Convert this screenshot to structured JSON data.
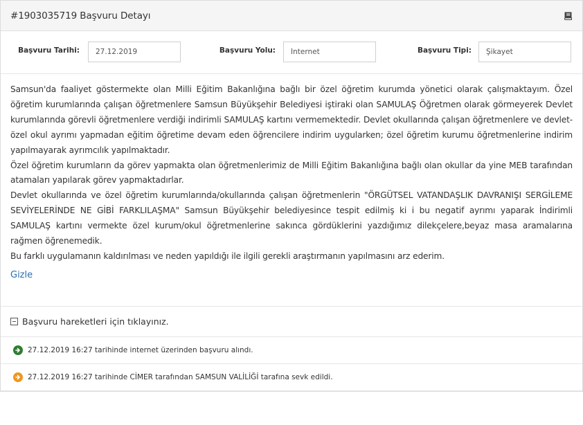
{
  "header": {
    "title": "#1903035719 Başvuru Detayı",
    "icon": "book-icon"
  },
  "fields": {
    "date_label": "Başvuru Tarihi:",
    "date_value": "27.12.2019",
    "channel_label": "Başvuru Yolu:",
    "channel_value": "İnternet",
    "type_label": "Başvuru Tipi:",
    "type_value": "Şikayet"
  },
  "description": {
    "paragraphs": [
      "Samsun'da faaliyet göstermekte olan Milli Eğitim Bakanlığına bağlı bir özel öğretim kurumda yönetici olarak çalışmaktayım. Özel öğretim kurumlarında çalışan öğretmenlere Samsun Büyükşehir Belediyesi iştiraki olan SAMULAŞ Öğretmen olarak görmeyerek Devlet kurumlarında görevli öğretmenlere verdiği indirimli SAMULAŞ kartını vermemektedir. Devlet okullarında çalışan öğretmenlere ve devlet-özel okul ayrımı yapmadan eğitim öğretime devam eden öğrencilere indirim uygularken; özel öğretim kurumu öğretmenlerine indirim yapılmayarak ayrımcılık yapılmaktadır.",
      "Özel öğretim kurumların da görev yapmakta olan öğretmenlerimiz de Milli Eğitim Bakanlığına bağlı olan okullar da yine MEB tarafından atamaları yapılarak görev yapmaktadırlar.",
      "Devlet okullarında ve özel öğretim kurumlarında/okullarında çalışan öğretmenlerin \"ÖRGÜTSEL VATANDAŞLIK DAVRANIŞI SERGİLEME SEVİYELERİNDE NE GİBİ FARKLILAŞMA\" Samsun Büyükşehir belediyesince tespit edilmiş ki i bu negatif ayrımı yaparak İndirimli SAMULAŞ kartını vermekte özel kurum/okul öğretmenlerine sakınca gördüklerini yazdığımız dilekçelere,beyaz masa aramalarına rağmen öğrenemedik.",
      "Bu farklı uygulamanın kaldırılması ve neden yapıldığı ile ilgili gerekli araştırmanın yapılmasını arz ederim."
    ],
    "hide_label": "Gizle"
  },
  "movements": {
    "toggle_label": "Başvuru hareketleri için tıklayınız.",
    "events": [
      {
        "text": "27.12.2019 16:27 tarihinde internet üzerinden başvuru alındı.",
        "icon": "arrow-right-circle-icon",
        "color": "#2e7d32"
      },
      {
        "text": "27.12.2019 16:27 tarihinde CİMER tarafından SAMSUN VALİLİĞİ tarafına sevk edildi.",
        "icon": "arrow-right-circle-icon",
        "color": "#f0961e"
      }
    ]
  },
  "colors": {
    "link": "#2a6fb0",
    "header_bg": "#f5f5f5",
    "border": "#e0e0e0"
  }
}
